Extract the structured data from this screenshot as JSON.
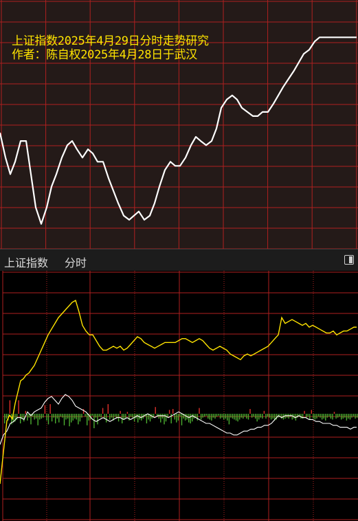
{
  "captions": {
    "title": "上证指数2025年4月29日分时走势研究",
    "author": "作者：陈自权2025年4月28日于武汉"
  },
  "colors": {
    "forecast_line": "#ffffff",
    "price_line": "#ffe400",
    "avg_line": "#ffffff",
    "volume_up": "#e0302a",
    "volume_down": "#4caf30",
    "grid_red": "#b02020"
  },
  "header": {
    "title": "上证指数",
    "mode": "分时",
    "toggle_icon": "panel-toggle-icon"
  },
  "chart_data": [
    {
      "type": "line",
      "name": "forecast",
      "x": [
        0,
        8,
        15,
        22,
        30,
        38,
        45,
        52,
        60,
        68,
        75,
        82,
        90,
        98,
        105,
        112,
        120,
        128,
        135,
        142,
        150,
        158,
        165,
        172,
        180,
        188,
        195,
        202,
        210,
        218,
        225,
        232,
        240,
        248,
        255,
        262,
        270,
        278,
        285,
        292,
        300,
        308,
        315,
        322,
        330,
        338,
        345,
        352,
        360,
        368,
        375,
        382,
        390,
        398,
        405,
        412,
        420,
        428,
        435,
        442,
        450,
        458,
        465,
        472,
        480,
        488,
        495,
        502,
        510,
        519
      ],
      "values": [
        68,
        62,
        58,
        61,
        66,
        66,
        58,
        50,
        46,
        50,
        55,
        58,
        62,
        65,
        66,
        64,
        62,
        64,
        63,
        61,
        61,
        57,
        54,
        51,
        48,
        47,
        48,
        49,
        47,
        48,
        51,
        55,
        59,
        61,
        60,
        60,
        62,
        65,
        67,
        66,
        65,
        66,
        69,
        74,
        76,
        77,
        76,
        74,
        73,
        72,
        72,
        73,
        73,
        75,
        77,
        79,
        81,
        83,
        85,
        87,
        88,
        90,
        91,
        91,
        91,
        91,
        91,
        91,
        91,
        91
      ],
      "ylim": [
        40,
        100
      ]
    },
    {
      "type": "line",
      "name": "price",
      "x": [
        0,
        3,
        6,
        10,
        14,
        18,
        22,
        26,
        30,
        34,
        38,
        42,
        46,
        50,
        55,
        60,
        65,
        70,
        75,
        80,
        85,
        90,
        95,
        100,
        105,
        110,
        115,
        120,
        125,
        130,
        135,
        140,
        145,
        150,
        155,
        160,
        165,
        170,
        175,
        180,
        185,
        190,
        195,
        200,
        205,
        210,
        215,
        220,
        225,
        230,
        235,
        240,
        245,
        250,
        255,
        260,
        265,
        270,
        275,
        280,
        285,
        290,
        295,
        300,
        305,
        310,
        315,
        320,
        325,
        330,
        335,
        340,
        345,
        350,
        355,
        360,
        365,
        370,
        375,
        380,
        385,
        390,
        395,
        400,
        405,
        410,
        415,
        420,
        425,
        430,
        435,
        440,
        445,
        450,
        455,
        460,
        465,
        470,
        475,
        480,
        485,
        490,
        495,
        500,
        505,
        510,
        515,
        519
      ],
      "values": [
        0,
        10,
        20,
        33,
        36,
        34,
        42,
        48,
        54,
        55,
        57,
        58,
        60,
        62,
        66,
        70,
        74,
        78,
        81,
        84,
        87,
        89,
        91,
        93,
        95,
        96,
        90,
        83,
        80,
        78,
        78,
        75,
        72,
        70,
        70,
        71,
        72,
        71,
        72,
        70,
        71,
        73,
        75,
        77,
        76,
        74,
        73,
        72,
        71,
        72,
        73,
        74,
        74,
        74,
        74,
        75,
        76,
        76,
        75,
        74,
        75,
        76,
        75,
        73,
        71,
        70,
        71,
        72,
        71,
        70,
        68,
        67,
        66,
        65,
        67,
        68,
        67,
        68,
        69,
        70,
        71,
        72,
        74,
        76,
        78,
        87,
        84,
        85,
        86,
        85,
        84,
        83,
        84,
        82,
        83,
        82,
        81,
        80,
        79,
        79,
        80,
        78,
        79,
        80,
        80,
        81,
        82,
        82
      ],
      "ylim": [
        0,
        100
      ]
    },
    {
      "type": "line",
      "name": "avg",
      "x": [
        0,
        5,
        10,
        15,
        20,
        25,
        30,
        35,
        40,
        45,
        50,
        55,
        60,
        65,
        70,
        75,
        80,
        85,
        90,
        95,
        100,
        105,
        110,
        115,
        120,
        125,
        130,
        135,
        140,
        145,
        150,
        155,
        160,
        165,
        170,
        175,
        180,
        185,
        190,
        195,
        200,
        205,
        210,
        215,
        220,
        225,
        230,
        235,
        240,
        245,
        250,
        255,
        260,
        265,
        270,
        275,
        280,
        285,
        290,
        295,
        300,
        305,
        310,
        315,
        320,
        325,
        330,
        335,
        340,
        345,
        350,
        355,
        360,
        365,
        370,
        375,
        380,
        385,
        390,
        395,
        400,
        405,
        410,
        415,
        420,
        425,
        430,
        435,
        440,
        445,
        450,
        455,
        460,
        465,
        470,
        475,
        480,
        485,
        490,
        495,
        500,
        505,
        510,
        515,
        519
      ],
      "values": [
        -32,
        -22,
        -18,
        -10,
        -8,
        -4,
        -4,
        -6,
        2,
        -2,
        2,
        4,
        6,
        12,
        16,
        18,
        14,
        10,
        16,
        20,
        18,
        14,
        8,
        6,
        4,
        2,
        -2,
        -6,
        -8,
        -6,
        -4,
        -6,
        -8,
        -6,
        -4,
        -4,
        -6,
        -4,
        -6,
        -4,
        -2,
        -4,
        -2,
        0,
        -2,
        -4,
        -2,
        -2,
        -2,
        -4,
        -2,
        0,
        2,
        0,
        -2,
        -4,
        -2,
        -4,
        -6,
        -8,
        -10,
        -10,
        -12,
        -14,
        -16,
        -18,
        -20,
        -20,
        -22,
        -22,
        -20,
        -18,
        -18,
        -16,
        -16,
        -14,
        -14,
        -12,
        -12,
        -10,
        -6,
        -2,
        -4,
        -2,
        -2,
        -2,
        -4,
        -2,
        -4,
        -4,
        -6,
        -6,
        -8,
        -8,
        -10,
        -10,
        -10,
        -12,
        -12,
        -14,
        -14,
        -14,
        -16,
        -14,
        -14
      ],
      "ylim": [
        -50,
        50
      ]
    },
    {
      "type": "bar",
      "name": "volume",
      "values": [
        -20,
        -10,
        -14,
        28,
        -22,
        -18,
        -16,
        -12,
        28,
        -20,
        -10,
        -16,
        6,
        -14,
        -8,
        -22,
        -6,
        -12,
        -10,
        -24,
        -12,
        -10,
        -8,
        18,
        -14,
        -22,
        20,
        -16,
        -8,
        -20,
        -10,
        -18,
        -6,
        -8,
        -24,
        -12,
        -10,
        -26,
        -18,
        -14,
        -10,
        -12,
        -22,
        -16,
        -8,
        10,
        -6,
        -24,
        -14,
        -12,
        -4,
        -30,
        -8,
        -22,
        -6,
        -8,
        12,
        -10,
        -18,
        20,
        -12,
        -8,
        -14,
        -6,
        -10,
        -16,
        6,
        -20,
        -12,
        -10,
        4,
        -14,
        -6,
        -8,
        -16,
        -10,
        -18,
        -12,
        -14,
        -10,
        -6,
        -20,
        -12,
        -16,
        -10,
        -8,
        14,
        -6,
        -10,
        -18,
        -10,
        -22,
        -16,
        -8,
        8,
        -20,
        10,
        -12,
        -18,
        -14,
        -6,
        -24,
        -10,
        -14,
        -12,
        -18,
        -20,
        -16,
        -10,
        -8,
        -14,
        12,
        -12,
        -8,
        -6,
        -4,
        -10,
        -12,
        -14,
        -8,
        -10,
        -6,
        -4,
        -10,
        -8,
        -12,
        -10,
        -14,
        -22,
        -8,
        -10,
        -12,
        -14,
        -16,
        -12,
        -8,
        -10,
        -6,
        -10,
        -12,
        10,
        -8,
        -6,
        -10,
        -16,
        -12,
        -8,
        -10,
        6,
        -10,
        -6,
        -8,
        -12,
        -10,
        -14,
        -12,
        -8,
        -6,
        -10,
        -12,
        -10,
        -8,
        -10,
        -6,
        -12,
        -10,
        -14,
        -8,
        -6,
        -10,
        -10,
        6,
        -8,
        -6,
        -12,
        8,
        -10,
        -12,
        -10,
        -6,
        -8,
        -12,
        -10,
        -14,
        -8,
        -6,
        -10,
        -12,
        4,
        -10,
        -8,
        -6,
        -12,
        -10,
        -8,
        -14,
        -10,
        -12,
        -8,
        -6,
        -10,
        -8
      ],
      "ylim": [
        -100,
        100
      ]
    }
  ]
}
